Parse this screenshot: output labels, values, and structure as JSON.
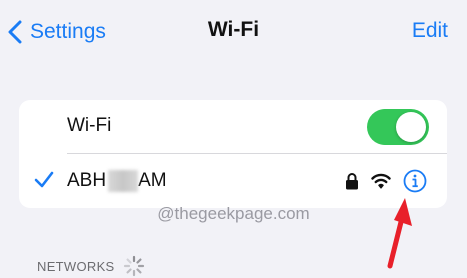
{
  "nav": {
    "back_label": "Settings",
    "title": "Wi-Fi",
    "edit_label": "Edit"
  },
  "wifi_row": {
    "label": "Wi-Fi",
    "toggle_on": true
  },
  "network_row": {
    "name_prefix": "ABH",
    "name_suffix": "AM",
    "secured": true,
    "connected": true
  },
  "watermark": "@thegeekpage.com",
  "section": {
    "label": "NETWORKS"
  },
  "colors": {
    "accent": "#1a7cf5",
    "toggle_on": "#34c759",
    "arrow": "#e8202a",
    "background": "#f2f2f7"
  },
  "icons": [
    "chevron-left-icon",
    "checkmark-icon",
    "lock-icon",
    "wifi-icon",
    "info-icon",
    "spinner-icon",
    "arrow-icon"
  ]
}
